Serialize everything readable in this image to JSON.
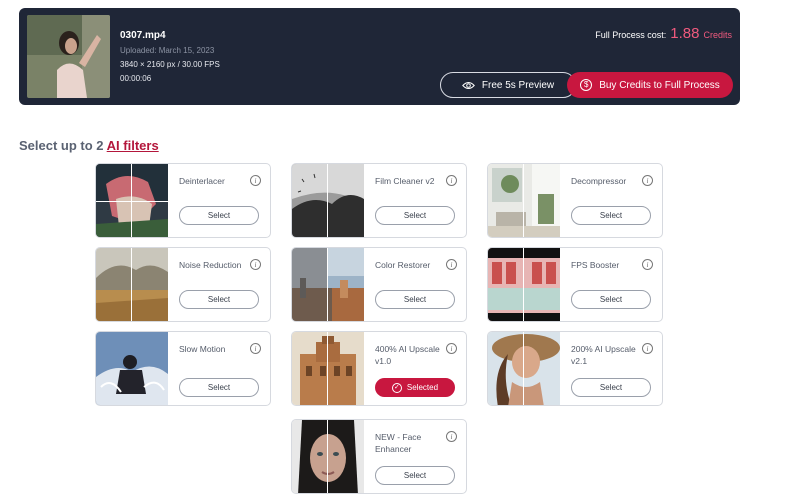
{
  "video": {
    "filename": "0307.mp4",
    "uploaded": "Uploaded: March 15, 2023",
    "resolution": "3840 × 2160 px / 30.00 FPS",
    "duration": "00:00:06",
    "thumbnail_icon": "video-thumbnail"
  },
  "cost": {
    "label": "Full Process cost:",
    "value": "1.88",
    "unit": "Credits"
  },
  "buttons": {
    "preview": "Free 5s Preview",
    "buy": "Buy Credits to Full Process"
  },
  "heading": {
    "prefix": "Select up to 2",
    "link": "AI filters"
  },
  "select_label": "Select",
  "selected_label": "Selected",
  "filters": [
    {
      "title": "Deinterlacer",
      "selected": false
    },
    {
      "title": "Film Cleaner v2",
      "selected": false
    },
    {
      "title": "Decompressor",
      "selected": false
    },
    {
      "title": "Noise Reduction",
      "selected": false
    },
    {
      "title": "Color Restorer",
      "selected": false
    },
    {
      "title": "FPS Booster",
      "selected": false
    },
    {
      "title": "Slow Motion",
      "selected": false
    },
    {
      "title": "400% AI Upscale v1.0",
      "selected": true
    },
    {
      "title": "200% AI Upscale v2.1",
      "selected": false
    },
    {
      "title": "NEW - Face Enhancer",
      "selected": false
    }
  ],
  "colors": {
    "header_bg": "#1f2637",
    "accent": "#c8173f",
    "cost_value": "#f05a7e"
  }
}
